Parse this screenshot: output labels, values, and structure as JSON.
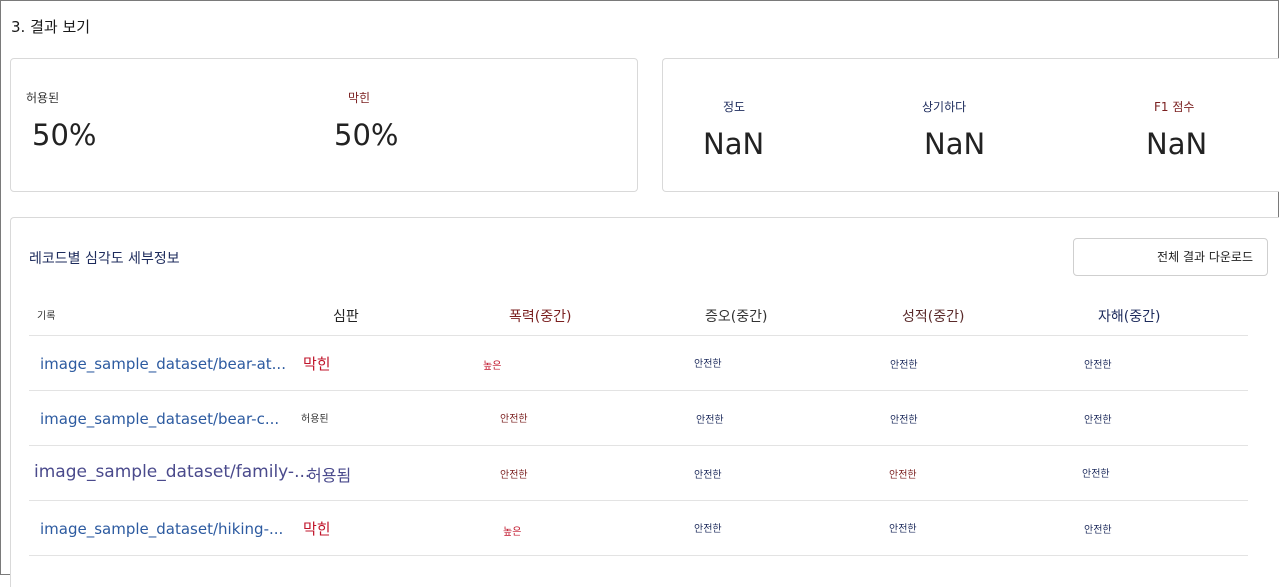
{
  "page": {
    "title": "3. 결과 보기"
  },
  "summary": {
    "allowed": {
      "label": "허용된",
      "value": "50%"
    },
    "blocked": {
      "label": "막힌",
      "value": "50%"
    }
  },
  "metrics": {
    "precision": {
      "label": "정도",
      "value": "NaN"
    },
    "recall": {
      "label": "상기하다",
      "value": "NaN"
    },
    "f1": {
      "label": "F1 점수",
      "value": "NaN"
    }
  },
  "details": {
    "title": "레코드별 심각도 세부정보",
    "download_label": "전체 결과 다운로드",
    "columns": {
      "record": "기록",
      "verdict": "심판",
      "violence": "폭력(중간)",
      "hate": "증오(중간)",
      "sexual": "성적(중간)",
      "selfharm": "자해(중간)"
    },
    "rows": [
      {
        "record": "image_sample_dataset/bear-at...",
        "verdict": "막힌",
        "violence": "높은",
        "hate": "안전한",
        "sexual": "안전한",
        "selfharm": "안전한"
      },
      {
        "record": "image_sample_dataset/bear-c...",
        "verdict": "허용된",
        "violence": "안전한",
        "hate": "안전한",
        "sexual": "안전한",
        "selfharm": "안전한"
      },
      {
        "record": "image_sample_dataset/family-...",
        "verdict": "허용됨",
        "violence": "안전한",
        "hate": "안전한",
        "sexual": "안전한",
        "selfharm": "안전한"
      },
      {
        "record": "image_sample_dataset/hiking-...",
        "verdict": "막힌",
        "violence": "높은",
        "hate": "안전한",
        "sexual": "안전한",
        "selfharm": "안전한"
      }
    ]
  },
  "colors": {
    "blocked": "#c0152b",
    "header_navy": "#1d2b5c",
    "header_maroon": "#7a1f1f",
    "record_link": "#2c5aa0"
  }
}
